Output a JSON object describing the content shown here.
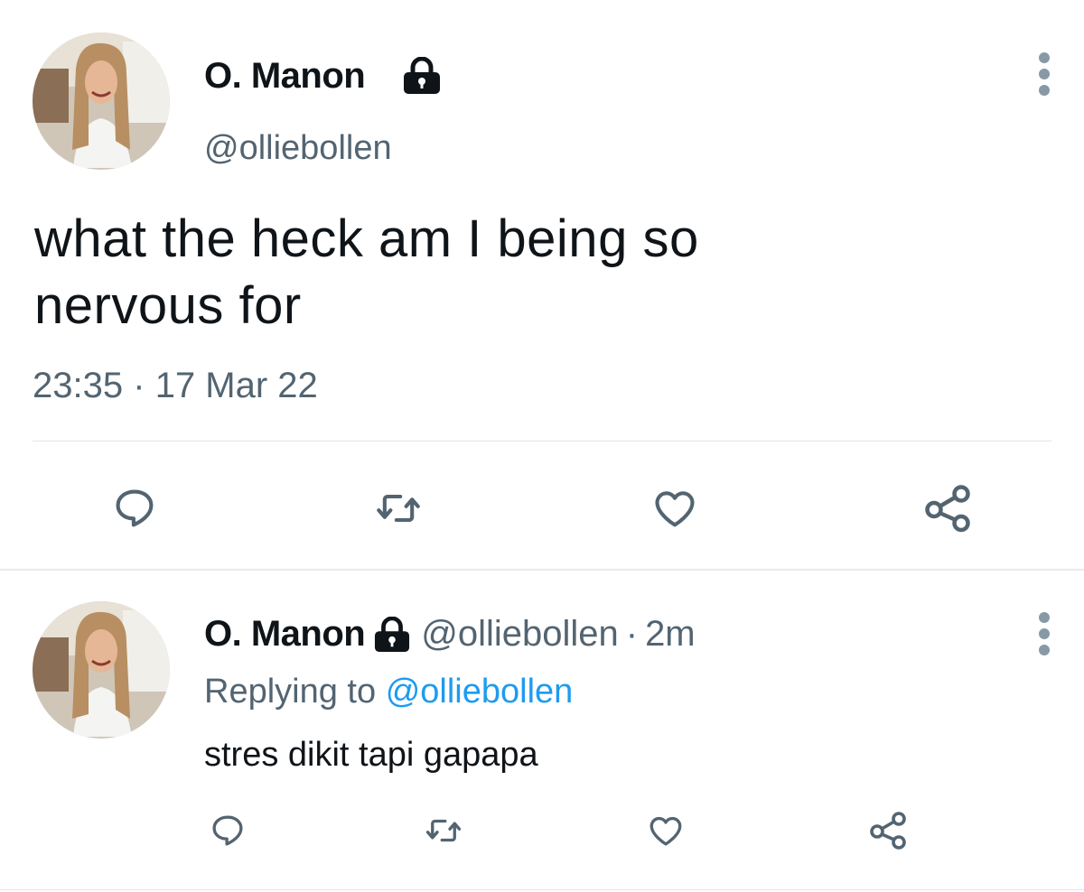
{
  "main_tweet": {
    "display_name": "O. Manon",
    "handle": "@olliebollen",
    "text_line1": "what the heck am I being so",
    "text_line2": "nervous for",
    "time": "23:35",
    "separator": "·",
    "date": "17 Mar 22",
    "icons": {
      "lock": "lock-icon",
      "more": "more-icon",
      "reply": "reply-icon",
      "retweet": "retweet-icon",
      "like": "heart-icon",
      "share": "share-icon"
    }
  },
  "reply_tweet": {
    "display_name": "O. Manon",
    "handle": "@olliebollen",
    "separator": "·",
    "relative_time": "2m",
    "replying_prefix": "Replying to",
    "replying_handle": "@olliebollen",
    "text": "stres dikit tapi gapapa"
  },
  "colors": {
    "text": "#0f1419",
    "secondary": "#536471",
    "link": "#1d9bf0",
    "icon": "#536471",
    "divider": "#e1e6ea"
  }
}
